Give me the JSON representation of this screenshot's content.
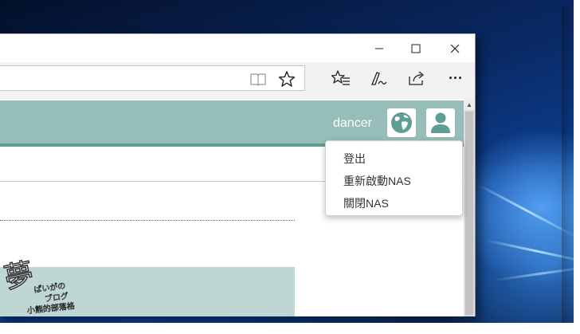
{
  "window": {
    "controls": {
      "minimize_icon": "minimize-icon",
      "maximize_icon": "maximize-icon",
      "close_icon": "close-icon"
    }
  },
  "toolbar": {
    "icons": [
      "reading-view-icon",
      "favorite-star-icon",
      "favorites-hub-icon",
      "web-note-icon",
      "share-icon",
      "more-icon"
    ],
    "more_label": "···"
  },
  "header": {
    "username": "dancer",
    "globe_icon": "globe-icon",
    "user_icon": "user-icon",
    "color": "#96bdb7",
    "accent": "#5e9e94"
  },
  "user_menu": {
    "items": [
      {
        "label": "登出"
      },
      {
        "label": "重新啟動NAS"
      },
      {
        "label": "關閉NAS"
      }
    ]
  },
  "watermark": {
    "text": "夢 ぱいがのブログ 小熊的部落格"
  }
}
